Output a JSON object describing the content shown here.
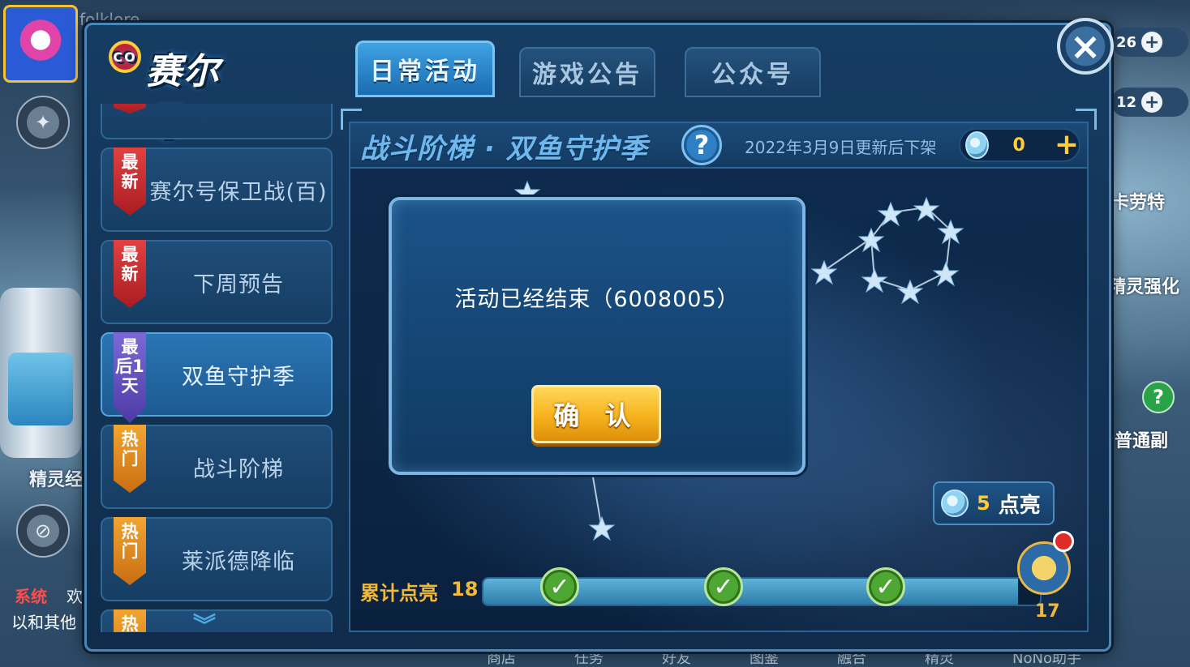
{
  "background": {
    "top_text": "folklore",
    "left_label": "精灵经",
    "chat": {
      "system_tag": "系统",
      "system_text": "欢",
      "line2": "以和其他"
    },
    "right_counters": [
      {
        "value": "26"
      },
      {
        "value": "12"
      }
    ],
    "right_labels": [
      "卡劳特",
      "精灵强化",
      "普通副"
    ],
    "help_icon": "?",
    "bottom_nav": [
      "商店",
      "任务",
      "好友",
      "图鉴",
      "融合",
      "精灵",
      "NoNo助手"
    ]
  },
  "panel": {
    "logo_text": "赛尔号",
    "logo_ring": "CO",
    "tabs": [
      {
        "label": "日常活动",
        "active": true
      },
      {
        "label": "游戏公告",
        "active": false
      },
      {
        "label": "公众号",
        "active": false
      }
    ],
    "close_icon": "×"
  },
  "sidebar": {
    "items": [
      {
        "badge": "最新",
        "badge_color": "red",
        "label": "赛尔号保卫战(百)",
        "active": false
      },
      {
        "badge": "最新",
        "badge_color": "red",
        "label": "下周预告",
        "active": false
      },
      {
        "badge": "最后1天",
        "badge_color": "purple",
        "label": "双鱼守护季",
        "active": true
      },
      {
        "badge": "热门",
        "badge_color": "orange",
        "label": "战斗阶梯",
        "active": false
      },
      {
        "badge": "热门",
        "badge_color": "orange",
        "label": "莱派德降临",
        "active": false
      },
      {
        "badge": "热",
        "badge_color": "orange",
        "label": "",
        "active": false
      }
    ],
    "scroll_icon": "chevron-double-down-icon"
  },
  "content": {
    "title": "战斗阶梯 · 双鱼守护季",
    "help_label": "?",
    "notice": "2022年3月9日更新后下架",
    "currency": {
      "value": "0",
      "plus": "+",
      "icon": "star-gem-icon"
    },
    "lightup": {
      "count": "5",
      "label": "点亮"
    },
    "progress": {
      "label": "累计点亮",
      "value": "18",
      "fraction": 0.96,
      "reward_count": "17"
    }
  },
  "modal": {
    "message": "活动已经结束（6008005）",
    "confirm_label": "确 认"
  },
  "colors": {
    "accent_gold": "#f1b93b",
    "panel_border": "#4b86b8",
    "confirm_yellow": "#f6b21c"
  }
}
